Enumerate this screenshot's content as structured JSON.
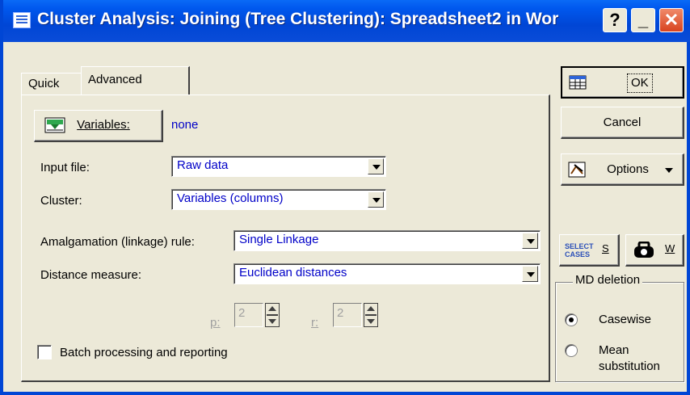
{
  "window": {
    "title": "Cluster Analysis: Joining (Tree Clustering): Spreadsheet2 in Wor",
    "help_label": "?",
    "minimize_label": "_",
    "close_label": "✕"
  },
  "tabs": [
    {
      "label": "Quick"
    },
    {
      "label": "Advanced"
    }
  ],
  "variables": {
    "button_label": "Variables:",
    "value": "none"
  },
  "input_file": {
    "label": "Input file:",
    "value": "Raw data"
  },
  "cluster": {
    "label": "Cluster:",
    "value": "Variables (columns)"
  },
  "amalgamation": {
    "label": "Amalgamation (linkage) rule:",
    "value": "Single Linkage"
  },
  "distance": {
    "label": "Distance measure:",
    "value": "Euclidean distances"
  },
  "p_param": {
    "label": "p:",
    "value": "2"
  },
  "r_param": {
    "label": "r:",
    "value": "2"
  },
  "batch": {
    "label": "Batch processing and reporting",
    "checked": false
  },
  "side": {
    "ok_label": "OK",
    "cancel_label": "Cancel",
    "options_label": "Options",
    "select_cases_line1": "SELECT",
    "select_cases_line2": "CASES",
    "select_cases_key": "S",
    "weight_key": "W"
  },
  "md_deletion": {
    "legend": "MD deletion",
    "options": [
      {
        "label": "Casewise",
        "selected": true
      },
      {
        "label_line1": "Mean",
        "label_line2": "substitution",
        "selected": false
      }
    ]
  },
  "colors": {
    "titlebar": "#0046D5",
    "dialog_bg": "#ECE9D8",
    "value_text": "#0000C8",
    "close_button": "#D8431F"
  },
  "icons": [
    "window-icon",
    "variables-icon",
    "spreadsheet-icon",
    "options-icon",
    "weight-icon",
    "dropdown-arrow-icon"
  ]
}
